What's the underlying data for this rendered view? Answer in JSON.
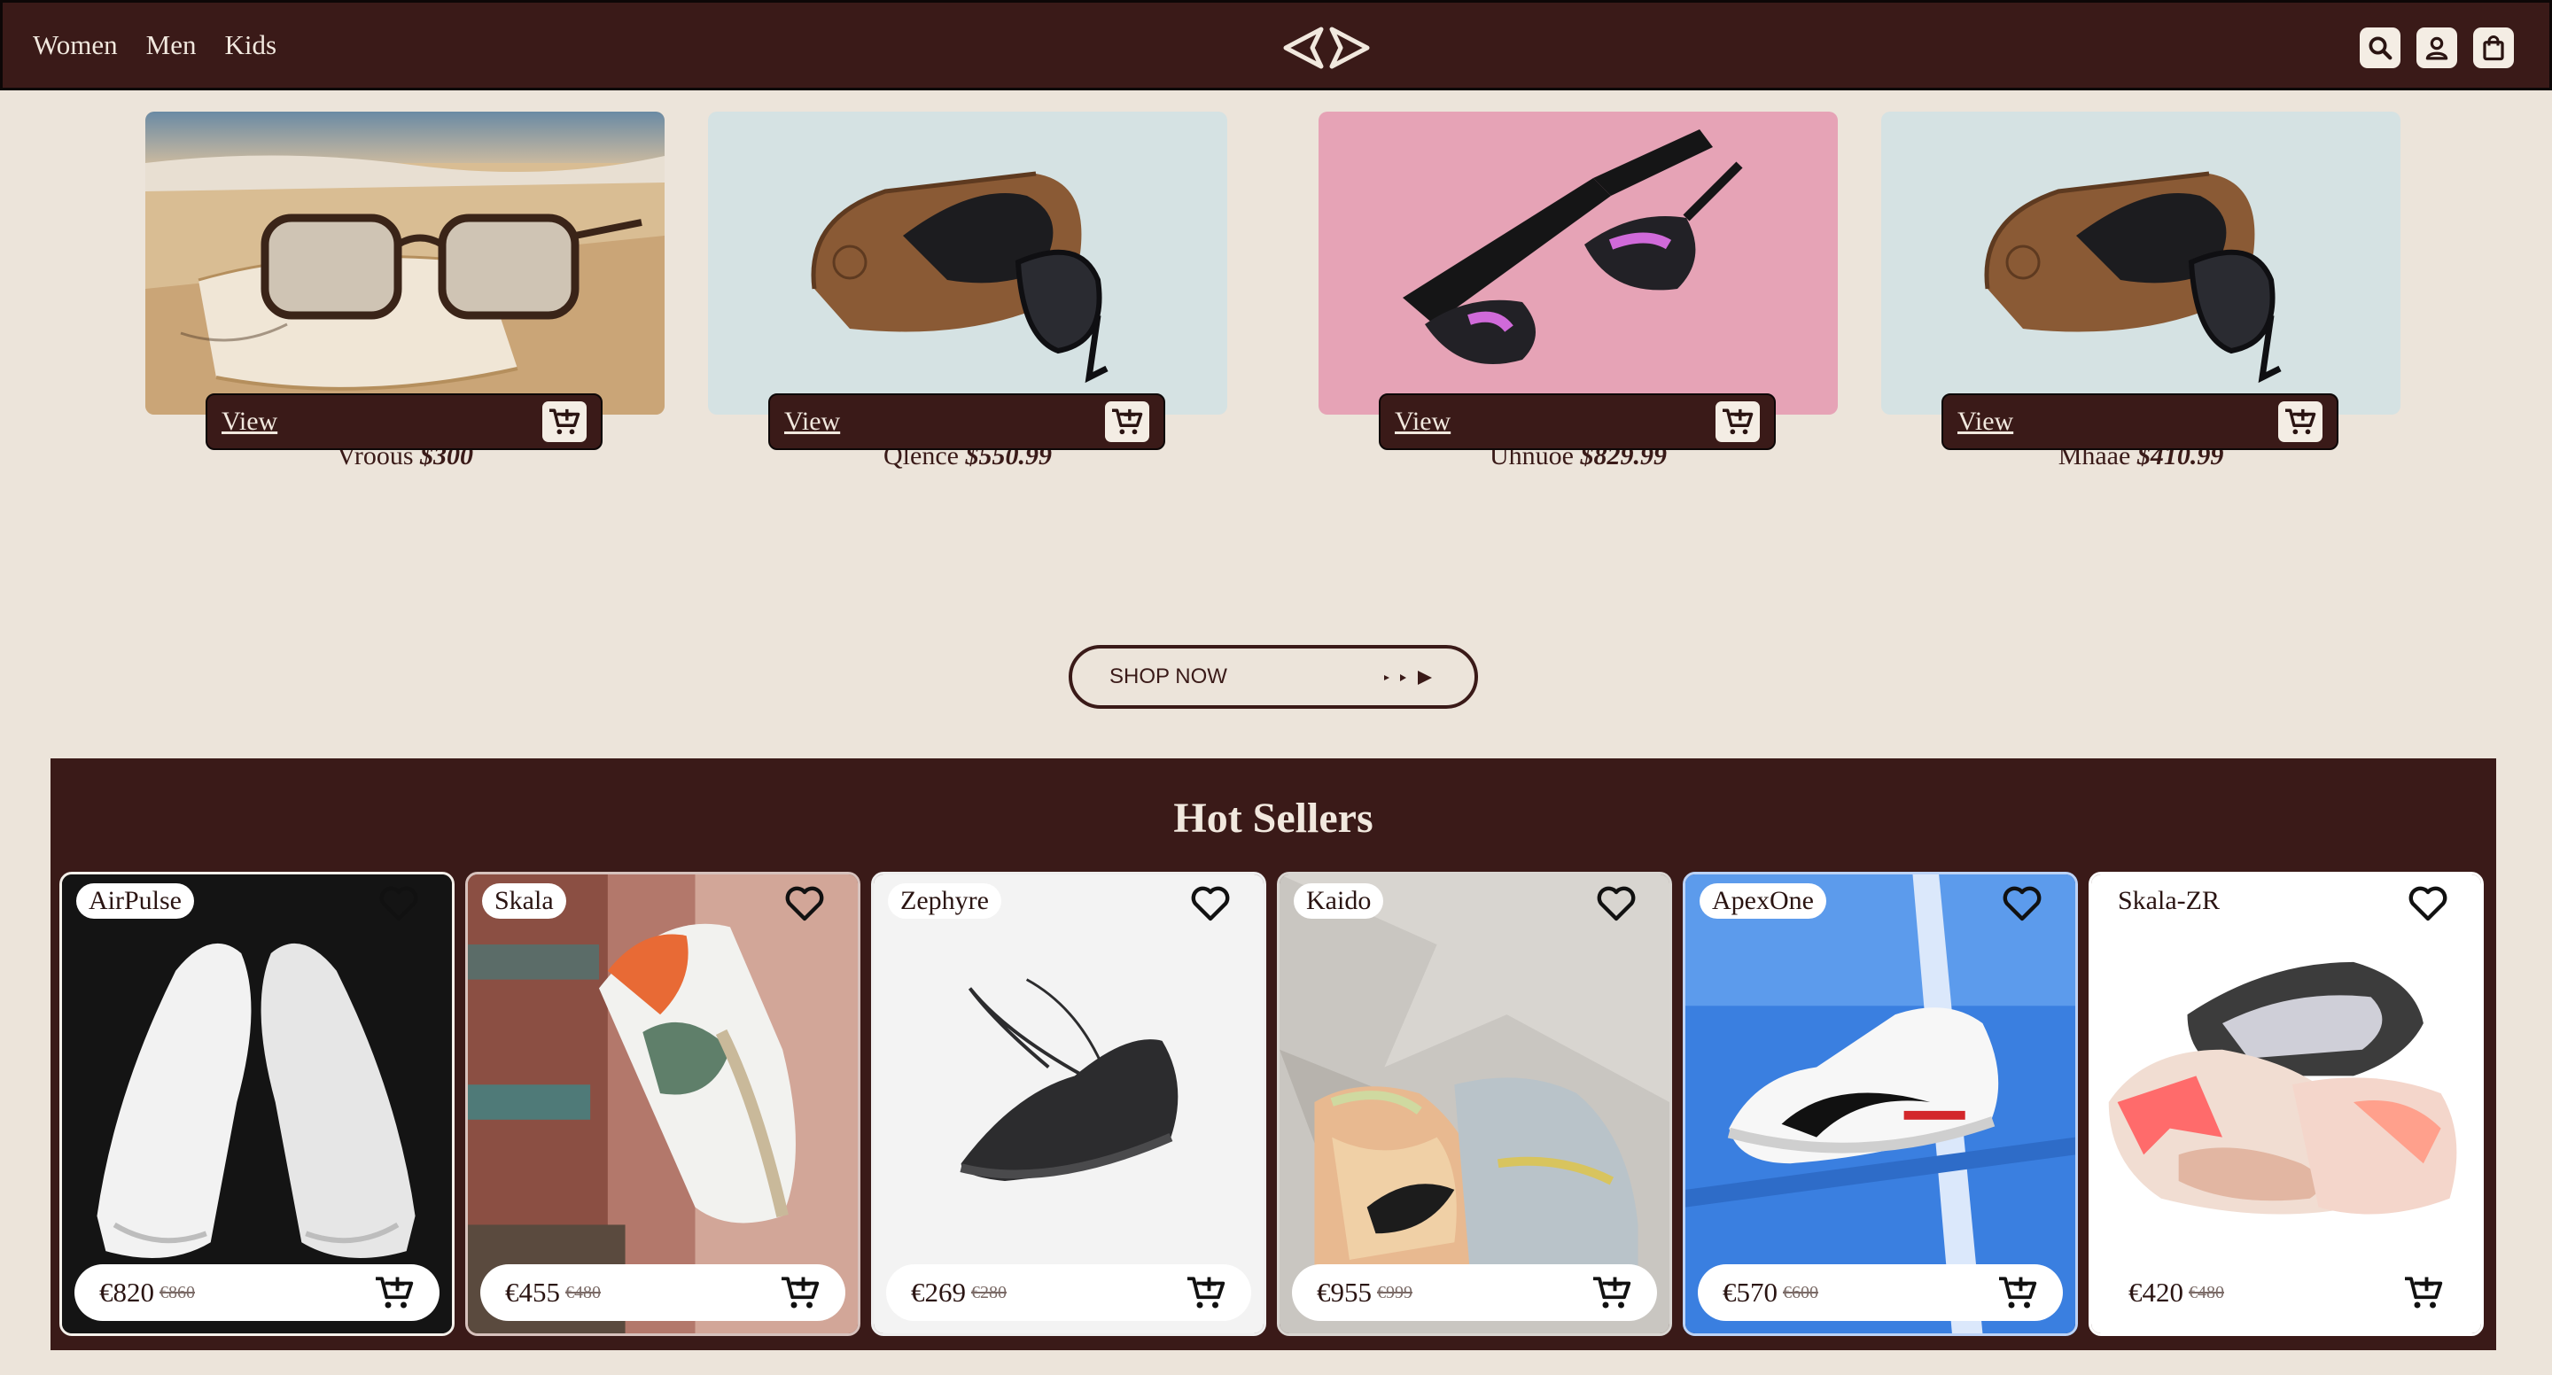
{
  "nav": {
    "women": "Women",
    "men": "Men",
    "kids": "Kids"
  },
  "header_icons": [
    "search-icon",
    "user-icon",
    "shopping-bag-icon"
  ],
  "products": [
    {
      "name": "Vroous",
      "price": "$300",
      "view": "View"
    },
    {
      "name": "Qlence",
      "price": "$550.99",
      "view": "View"
    },
    {
      "name": "Uhnuoe",
      "price": "$829.99",
      "view": "View"
    },
    {
      "name": "Mhaae",
      "price": "$410.99",
      "view": "View"
    }
  ],
  "shop_now": "SHOP NOW",
  "hot_sellers": {
    "title": "Hot Sellers",
    "items": [
      {
        "name": "AirPulse",
        "price": "€820",
        "old_price": "€860"
      },
      {
        "name": "Skala",
        "price": "€455",
        "old_price": "€480"
      },
      {
        "name": "Zephyre",
        "price": "€269",
        "old_price": "€280"
      },
      {
        "name": "Kaido",
        "price": "€955",
        "old_price": "€999"
      },
      {
        "name": "ApexOne",
        "price": "€570",
        "old_price": "€600"
      },
      {
        "name": "Skala-ZR",
        "price": "€420",
        "old_price": "€480"
      }
    ]
  },
  "colors": {
    "brand": "#3a1a18",
    "background": "#ece4da",
    "surface": "#f4ede4"
  }
}
